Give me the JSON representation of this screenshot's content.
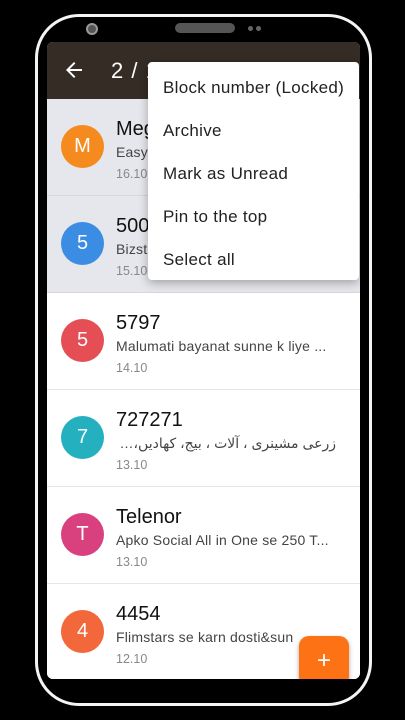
{
  "header": {
    "selection_count": "2 / 1"
  },
  "menu": {
    "items": [
      {
        "label": "Block number (Locked)"
      },
      {
        "label": "Archive"
      },
      {
        "label": "Mark as Unread"
      },
      {
        "label": "Pin to the top"
      },
      {
        "label": "Select all"
      }
    ]
  },
  "conversations": [
    {
      "initial": "M",
      "name": "Meg",
      "snippet": "Easy",
      "date": "16.10",
      "color": "#f58a1f",
      "selected": true
    },
    {
      "initial": "5",
      "name": "500",
      "snippet": "Bizst",
      "date": "15.10",
      "color": "#3b8de4",
      "selected": true
    },
    {
      "initial": "5",
      "name": "5797",
      "snippet": "Malumati bayanat sunne k liye ...",
      "date": "14.10",
      "color": "#e64e55",
      "selected": false
    },
    {
      "initial": "7",
      "name": "727271",
      "snippet": "زرعی مشینری ، آلات ، بیج، کھادیں، اور ...",
      "date": "13.10",
      "color": "#25b0c0",
      "selected": false
    },
    {
      "initial": "T",
      "name": "Telenor",
      "snippet": "Apko Social All in One se 250 T...",
      "date": "13.10",
      "color": "#d9407e",
      "selected": false
    },
    {
      "initial": "4",
      "name": "4454",
      "snippet": "Flimstars se karn dosti&sun",
      "date": "12.10",
      "color": "#f2683b",
      "selected": false
    }
  ],
  "fab": {
    "label": "+"
  },
  "colors": {
    "appbar": "#352c25",
    "accent": "#fd7215"
  }
}
